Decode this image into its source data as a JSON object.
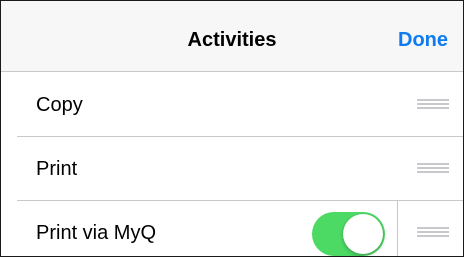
{
  "header": {
    "title": "Activities",
    "done_label": "Done"
  },
  "activities": [
    {
      "label": "Copy",
      "has_toggle": false
    },
    {
      "label": "Print",
      "has_toggle": false
    },
    {
      "label": "Print via MyQ",
      "has_toggle": true,
      "toggle_on": true
    }
  ],
  "colors": {
    "accent": "#0e7cf0",
    "toggle_on": "#4cd964",
    "separator": "#c8c7cc",
    "navbar_bg": "#f7f7f7"
  },
  "icons": {
    "reorder": "reorder-grabber-icon"
  }
}
